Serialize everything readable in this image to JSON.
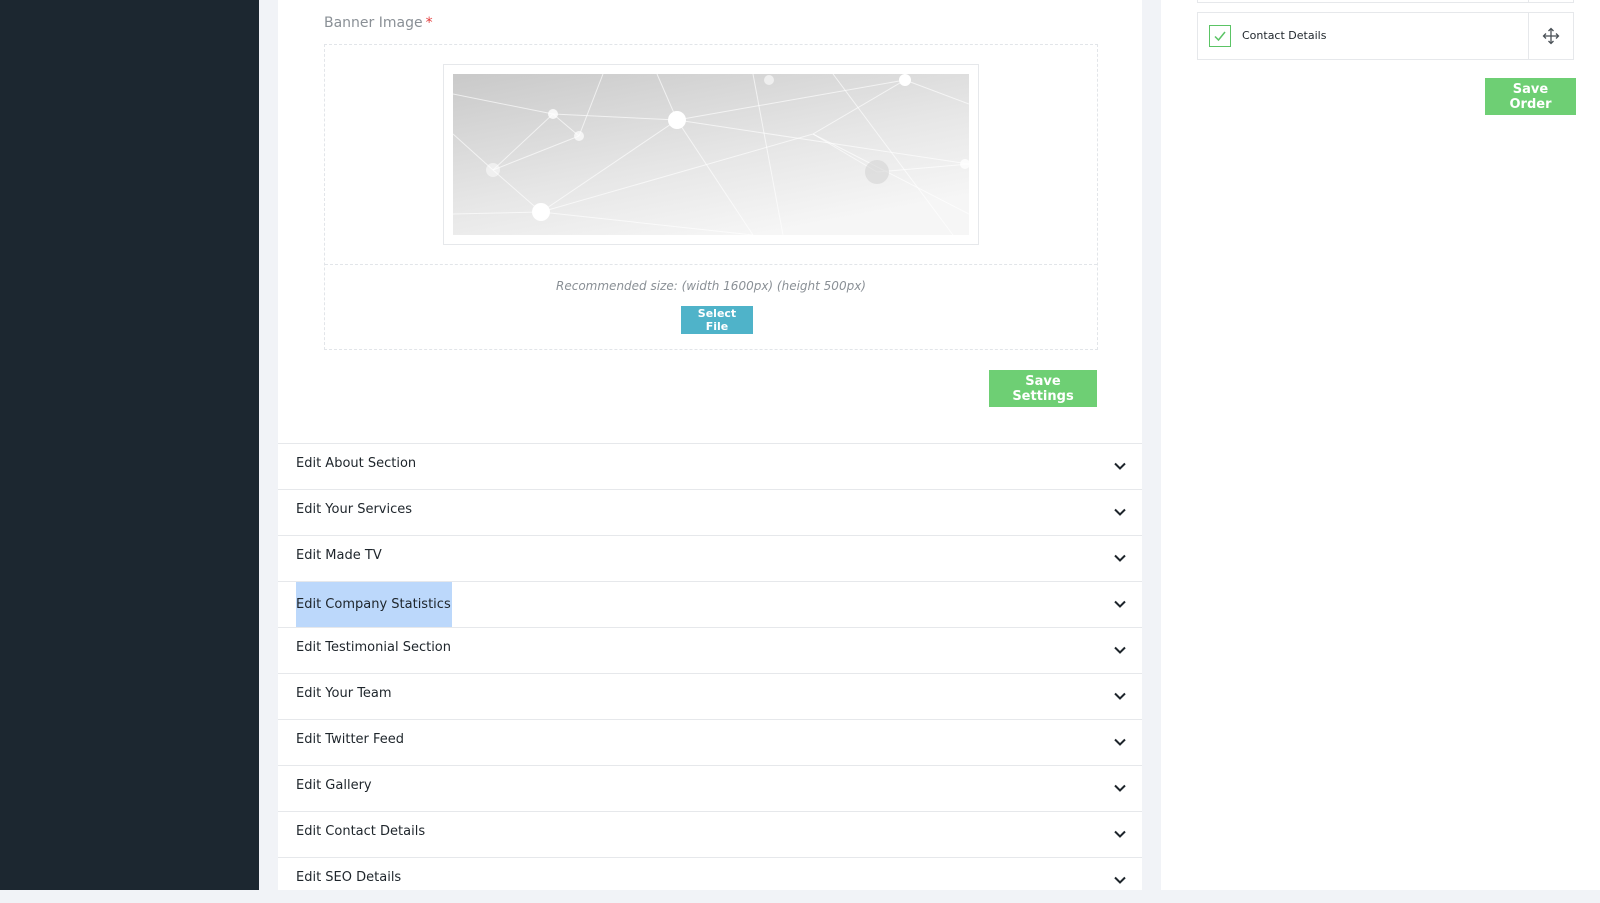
{
  "colors": {
    "sidebar_bg": "#1c2730",
    "page_bg": "#f1f3f7",
    "accent_green": "#6ecf74",
    "accent_blue": "#4fb3c9",
    "required_red": "#e23b3b",
    "selection": "#bcd8fb"
  },
  "banner": {
    "label": "Banner Image",
    "required_mark": "*",
    "recommended_size": "Recommended size: (width 1600px) (height 500px)",
    "select_file_label": "Select File",
    "save_settings_label": "Save Settings"
  },
  "accordion": {
    "items": [
      {
        "title": "Edit About Section",
        "icon": "chevron-down-icon"
      },
      {
        "title": "Edit Your Services",
        "icon": "chevron-down-icon"
      },
      {
        "title": "Edit Made TV",
        "icon": "chevron-down-icon"
      },
      {
        "title": "Edit Company Statistics",
        "icon": "chevron-down-icon",
        "selected": true
      },
      {
        "title": "Edit Testimonial Section",
        "icon": "chevron-down-icon"
      },
      {
        "title": "Edit Your Team",
        "icon": "chevron-down-icon"
      },
      {
        "title": "Edit Twitter Feed",
        "icon": "chevron-down-icon"
      },
      {
        "title": "Edit Gallery",
        "icon": "chevron-down-icon"
      },
      {
        "title": "Edit Contact Details",
        "icon": "chevron-down-icon"
      },
      {
        "title": "Edit SEO Details",
        "icon": "chevron-down-icon"
      }
    ]
  },
  "section_order": {
    "item": {
      "label": "Contact Details",
      "checked": true,
      "handle_icon": "move-icon"
    },
    "save_order_label": "Save Order"
  }
}
